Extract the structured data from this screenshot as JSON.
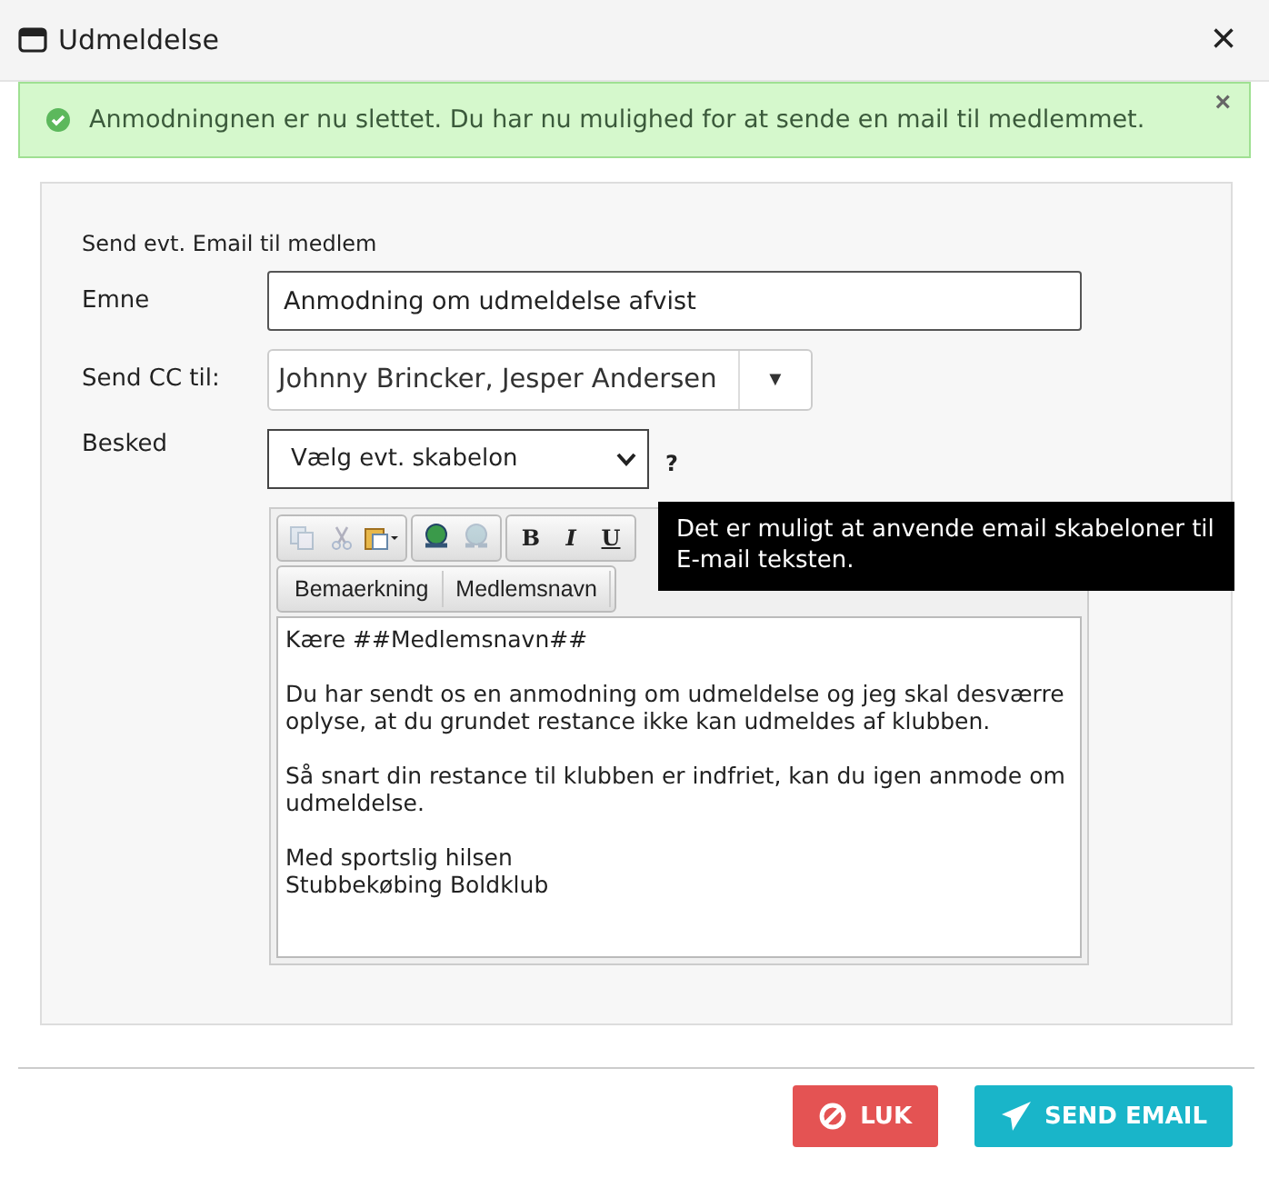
{
  "window": {
    "title": "Udmeldelse",
    "close": "×"
  },
  "alert": {
    "text": "Anmodningnen er nu slettet. Du har nu mulighed for at sende en mail til medlemmet.",
    "close": "×"
  },
  "form": {
    "heading": "Send evt. Email til medlem",
    "subject": {
      "label": "Emne",
      "value": "Anmodning om udmeldelse afvist"
    },
    "cc": {
      "label": "Send CC til:",
      "value": "Johnny Brincker, Jesper Andersen",
      "toggle": "▼"
    },
    "message": {
      "label": "Besked",
      "template": "Vælg evt. skabelon",
      "help": "?"
    },
    "tooltip": "Det er muligt at anvende email skabeloner til E-mail teksten."
  },
  "editor": {
    "toolbar": [
      [
        {
          "kind": "copy",
          "disabled": true
        },
        {
          "kind": "cut",
          "disabled": true
        },
        {
          "kind": "paste",
          "disabled": false
        }
      ],
      [
        {
          "kind": "link",
          "disabled": false
        },
        {
          "kind": "unlink",
          "disabled": true
        }
      ],
      [
        {
          "kind": "bold",
          "label": "B",
          "disabled": false
        },
        {
          "kind": "italic",
          "label": "I",
          "disabled": false
        },
        {
          "kind": "underline",
          "label": "U",
          "disabled": false
        }
      ]
    ],
    "merge_fields": [
      "Bemaerkning",
      "Medlemsnavn"
    ],
    "paragraphs": [
      [
        "Kære ##Medlemsnavn##"
      ],
      [
        "Du har sendt os en anmodning om udmeldelse og jeg skal desværre oplyse, at du grundet restance ikke kan udmeldes af klubben."
      ],
      [
        "Så snart din restance til klubben er indfriet, kan du igen anmode om udmeldelse."
      ],
      [
        "Med sportslig hilsen",
        "Stubbekøbing Boldklub"
      ]
    ]
  },
  "buttons": [
    {
      "kind": "danger",
      "label": "LUK"
    },
    {
      "kind": "primary",
      "label": "SEND EMAIL"
    }
  ]
}
